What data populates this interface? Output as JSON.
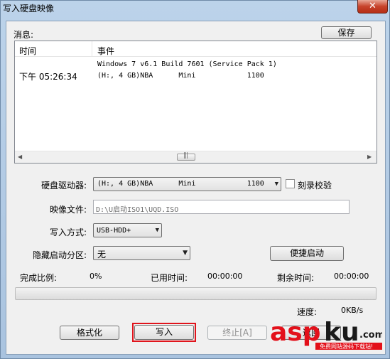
{
  "window": {
    "title": "写入硬盘映像",
    "close_glyph": "✕"
  },
  "messages": {
    "label": "消息:",
    "save_button": "保存",
    "columns": {
      "time": "时间",
      "event": "事件"
    },
    "rows": [
      {
        "time": "",
        "event": "Windows 7 v6.1 Build 7601 (Service Pack 1)"
      },
      {
        "time": "下午 05:26:34",
        "event": "(H:, 4 GB)NBA      Mini            1100"
      }
    ]
  },
  "drive": {
    "label": "硬盘驱动器:",
    "selected": "(H:, 4 GB)NBA      Mini            1100",
    "verify_label": "刻录校验",
    "verify_checked": false
  },
  "image_file": {
    "label": "映像文件:",
    "value": "D:\\U启动ISO1\\UQD.ISO"
  },
  "write_mode": {
    "label": "写入方式:",
    "selected": "USB-HDD+"
  },
  "hidden_partition": {
    "label": "隐藏启动分区:",
    "selected": "无",
    "quick_boot_button": "便捷启动"
  },
  "status": {
    "done_ratio_label": "完成比例:",
    "done_ratio_value": "0%",
    "elapsed_label": "已用时间:",
    "elapsed_value": "00:00:00",
    "remaining_label": "剩余时间:",
    "remaining_value": "00:00:00",
    "progress": 0,
    "speed_label": "速度:",
    "speed_value": "0KB/s"
  },
  "buttons": {
    "format": "格式化",
    "write": "写入",
    "abort": "终止[A]",
    "return": "返回"
  },
  "watermark": {
    "logo_text": "aspku",
    "logo_suffix": ".com",
    "tagline": "免费网站源码下载站!"
  },
  "colors": {
    "highlight_border": "#e0141c",
    "watermark_red": "#e3101a",
    "watermark_dark": "#1a1a1a"
  }
}
